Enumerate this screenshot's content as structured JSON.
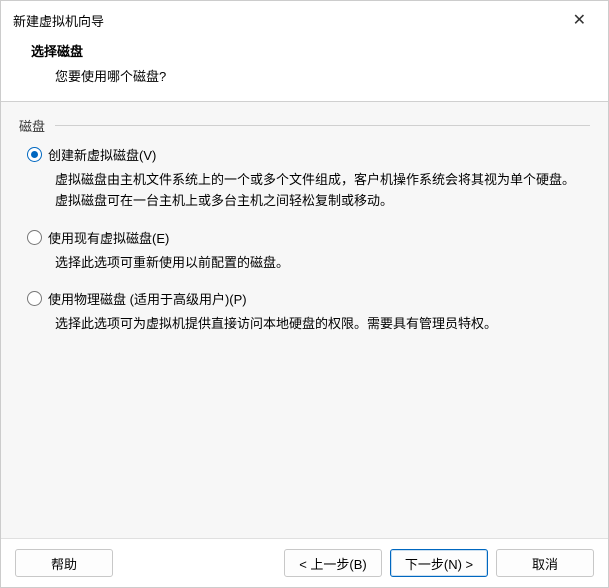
{
  "window": {
    "title": "新建虚拟机向导"
  },
  "header": {
    "title": "选择磁盘",
    "subtitle": "您要使用哪个磁盘?"
  },
  "fieldset": {
    "label": "磁盘"
  },
  "options": {
    "create": {
      "label": "创建新虚拟磁盘(V)",
      "desc": "虚拟磁盘由主机文件系统上的一个或多个文件组成，客户机操作系统会将其视为单个硬盘。虚拟磁盘可在一台主机上或多台主机之间轻松复制或移动。",
      "selected": true
    },
    "existing": {
      "label": "使用现有虚拟磁盘(E)",
      "desc": "选择此选项可重新使用以前配置的磁盘。",
      "selected": false
    },
    "physical": {
      "label": "使用物理磁盘 (适用于高级用户)(P)",
      "desc": "选择此选项可为虚拟机提供直接访问本地硬盘的权限。需要具有管理员特权。",
      "selected": false
    }
  },
  "buttons": {
    "help": "帮助",
    "back": "< 上一步(B)",
    "next": "下一步(N) >",
    "cancel": "取消"
  }
}
